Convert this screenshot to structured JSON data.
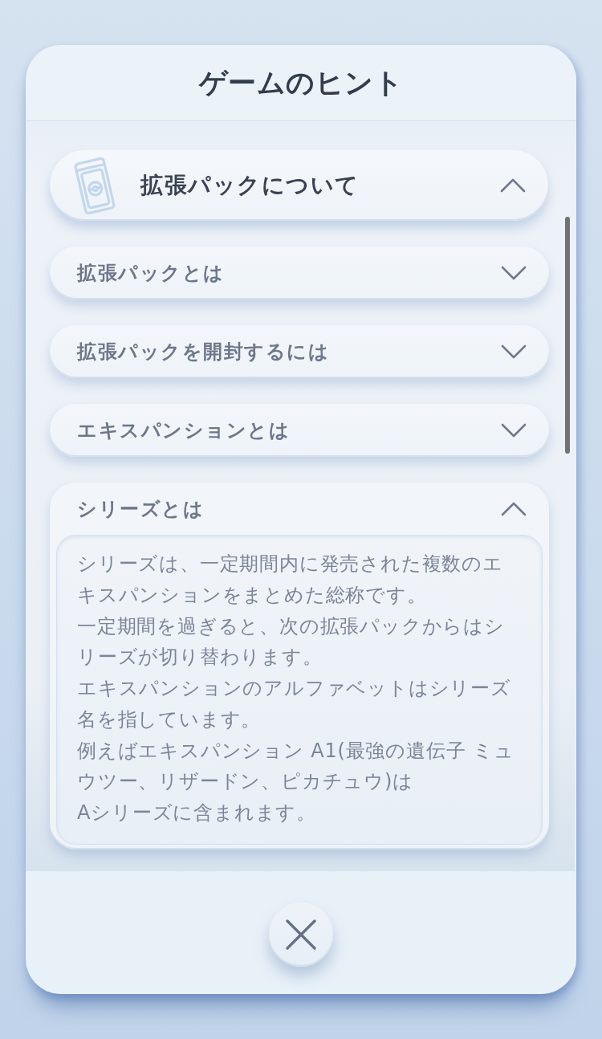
{
  "dialog": {
    "title": "ゲームのヒント"
  },
  "section": {
    "title": "拡張パックについて",
    "expanded": true
  },
  "items": [
    {
      "title": "拡張パックとは",
      "expanded": false
    },
    {
      "title": "拡張パックを開封するには",
      "expanded": false
    },
    {
      "title": "エキスパンションとは",
      "expanded": false
    },
    {
      "title": "シリーズとは",
      "expanded": true,
      "body": [
        "シリーズは、一定期間内に発売された複数のエキスパンションをまとめた総称です。",
        "一定期間を過ぎると、次の拡張パックからはシリーズが切り替わります。",
        "エキスパンションのアルファベットはシリーズ名を指しています。",
        "例えばエキスパンション A1(最強の遺伝子 ミュウツー、リザードン、ピカチュウ)は",
        "Aシリーズに含まれます。"
      ]
    }
  ]
}
